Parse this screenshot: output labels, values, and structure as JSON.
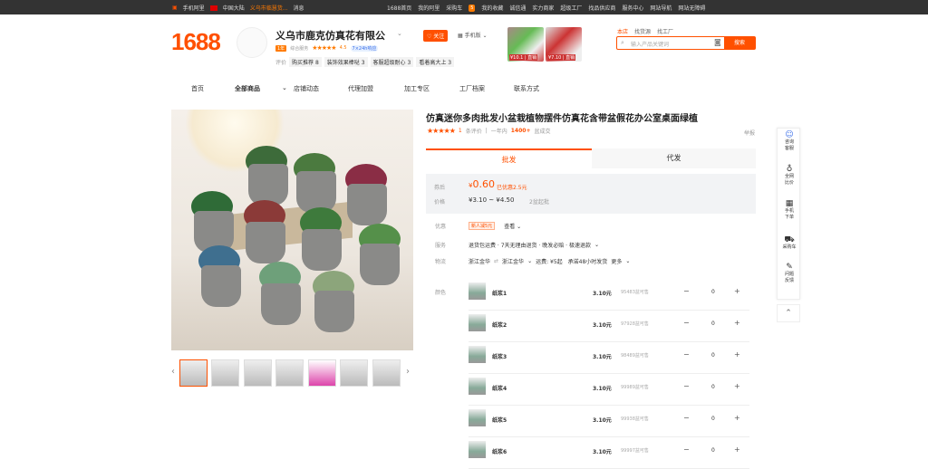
{
  "topbar": {
    "left": [
      "手机阿里",
      "中国大陆",
      "义乌市临慧货...",
      "消息"
    ],
    "right": [
      "1688首页",
      "我的阿里",
      "采购车",
      "5",
      "我的收藏",
      "诚信通",
      "实力商家",
      "超级工厂",
      "找品供应商",
      "服务中心",
      "网站导航",
      "网站无障碍"
    ]
  },
  "logo": "1688",
  "shop": {
    "name": "义乌市鹿克仿真花有限公",
    "years": "1年",
    "rating_label": "综合服务",
    "stars": "★★★★★",
    "score": "4.5",
    "response": "7×24h响应",
    "reviews_label": "评价",
    "reviews": [
      {
        "t": "购买推荐",
        "n": "8"
      },
      {
        "t": "装饰效果棒哒",
        "n": "3"
      },
      {
        "t": "客服超级耐心",
        "n": "3"
      },
      {
        "t": "看着高大上",
        "n": "3"
      }
    ],
    "follow": "关注",
    "mobile": "手机版"
  },
  "top_thumbs": [
    {
      "label": "¥10.1 | 直销"
    },
    {
      "label": "¥7.10 | 直销"
    }
  ],
  "search": {
    "tabs": [
      "本店",
      "找货源",
      "找工厂"
    ],
    "placeholder": "输入产品关键词",
    "button": "搜索"
  },
  "nav": [
    "首页",
    "全部商品",
    "店铺动态",
    "代理加盟",
    "加工专区",
    "工厂档案",
    "联系方式"
  ],
  "product": {
    "title": "仿真迷你多肉批发小盆栽植物摆件仿真花含带盆假花办公室桌面绿植",
    "stars": "★★★★★",
    "review_count": "1",
    "review_label": "条评价",
    "sold_prefix": "一年内",
    "sold": "1400+",
    "sold_suffix": "盆成交",
    "report": "举报"
  },
  "tabs": {
    "wholesale": "批发",
    "agent": "代发"
  },
  "price": {
    "after_label": "券后",
    "after": "0.60",
    "discount": "已优惠2.5元",
    "price_label": "价格",
    "low": "¥3.10",
    "high": "¥4.50",
    "moq": "2盆起批"
  },
  "info": {
    "promo_label": "优惠",
    "promo_tag": "新人减5元",
    "promo_more": "查看",
    "service_label": "服务",
    "service": "退货包运费 · 7天无理由退货 · 晚发必赔 · 极速退款",
    "logistics_label": "物流",
    "from": "浙江金华",
    "to": "浙江金华",
    "shipping": "运费: ¥5起",
    "promise": "承诺48小时发货",
    "more": "更多"
  },
  "color_label": "颜色",
  "items": [
    {
      "name": "纸浆1",
      "price": "3.10元",
      "stock": "95483盆可售",
      "qty": "0"
    },
    {
      "name": "纸浆2",
      "price": "3.10元",
      "stock": "97928盆可售",
      "qty": "0"
    },
    {
      "name": "纸浆3",
      "price": "3.10元",
      "stock": "98489盆可售",
      "qty": "0"
    },
    {
      "name": "纸浆4",
      "price": "3.10元",
      "stock": "99989盆可售",
      "qty": "0"
    },
    {
      "name": "纸浆5",
      "price": "3.10元",
      "stock": "99938盆可售",
      "qty": "0"
    },
    {
      "name": "纸浆6",
      "price": "3.10元",
      "stock": "99997盆可售",
      "qty": "0"
    }
  ],
  "sidebar": [
    {
      "l1": "咨询",
      "l2": "客服",
      "icon": "☺"
    },
    {
      "l1": "全网",
      "l2": "比价",
      "icon": "♁"
    },
    {
      "l1": "手机",
      "l2": "下单",
      "icon": "▦"
    },
    {
      "l1": "采购车",
      "l2": "",
      "icon": "⛟"
    },
    {
      "l1": "问题",
      "l2": "反馈",
      "icon": "✎"
    }
  ],
  "colors": {
    "brand": "#ff5000",
    "accent": "#ff7a00"
  }
}
